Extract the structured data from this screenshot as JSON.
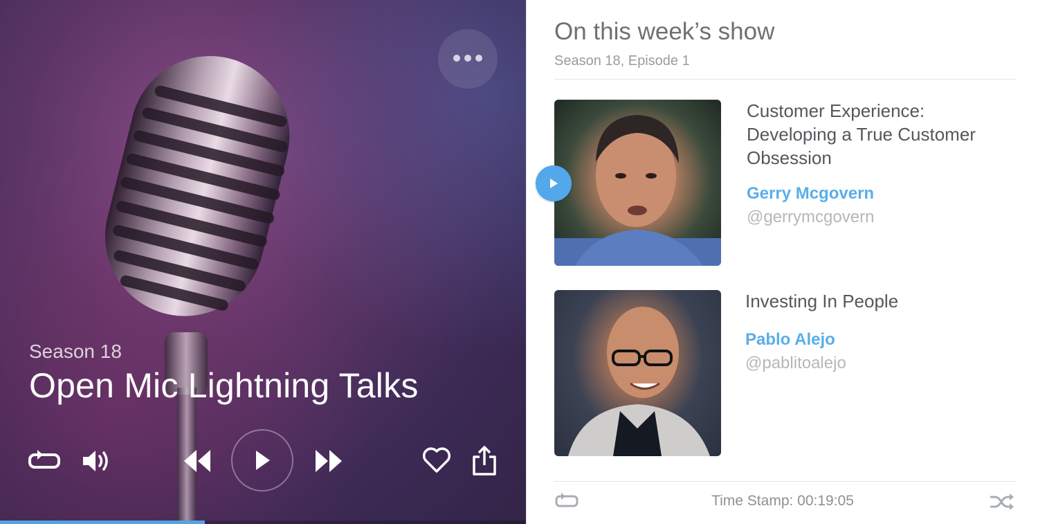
{
  "player": {
    "season": "Season 18",
    "title": "Open Mic Lightning Talks",
    "progress": 0.39,
    "icons": [
      "more-icon",
      "repeat-icon",
      "volume-icon",
      "rewind-icon",
      "play-icon",
      "fast-forward-icon",
      "heart-icon",
      "share-icon"
    ]
  },
  "episode": {
    "heading": "On this week’s show",
    "subheading": "Season 18, Episode 1",
    "talks": [
      {
        "title_lines": [
          "Customer Experience:",
          "Developing a True Customer",
          "Obsession"
        ],
        "speaker": "Gerry Mcgovern",
        "handle": "@gerrymcgovern"
      },
      {
        "title_lines": [
          "Investing In People"
        ],
        "speaker": "Pablo Alejo",
        "handle": "@pablitoalejo"
      }
    ],
    "timestamp": "Time Stamp: 00:19:05"
  },
  "colors": {
    "accent": "#56a3e2",
    "speaker_name": "#5aaee8",
    "panel_bg": "#ffffff"
  }
}
